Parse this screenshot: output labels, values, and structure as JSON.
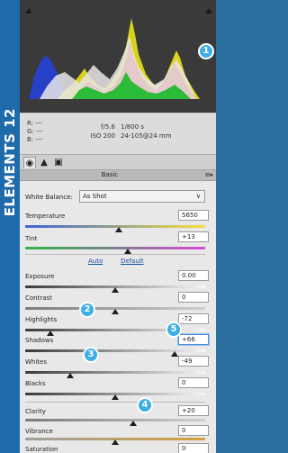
{
  "brand": {
    "label": "ELEMENTS 12",
    "color": "#1f6aa8"
  },
  "callouts": [
    "1",
    "2",
    "3",
    "4",
    "5"
  ],
  "info": {
    "r_label": "R:",
    "r_value": "---",
    "g_label": "G:",
    "g_value": "---",
    "b_label": "B:",
    "b_value": "---",
    "aperture": "f/5.6",
    "shutter": "1/800 s",
    "iso": "ISO 200",
    "lens": "24-105@24 mm"
  },
  "tabs": {
    "basic_icon": "aperture-icon",
    "detail_icon": "triangle-icon",
    "camera_icon": "camera-icon"
  },
  "section": {
    "title": "Basic",
    "menu_glyph": "≡▸"
  },
  "white_balance": {
    "label": "White Balance:",
    "value": "As Shot"
  },
  "controls": [
    {
      "label": "Temperature",
      "value": "5650",
      "level": 0.52
    },
    {
      "label": "Tint",
      "value": "+13",
      "level": 0.57
    },
    {
      "label": "Exposure",
      "value": "0.00",
      "level": 0.5
    },
    {
      "label": "Contrast",
      "value": "0",
      "level": 0.5
    },
    {
      "label": "Highlights",
      "value": "-72",
      "level": 0.14
    },
    {
      "label": "Shadows",
      "value": "+66",
      "level": 0.83
    },
    {
      "label": "Whites",
      "value": "-49",
      "level": 0.25
    },
    {
      "label": "Blacks",
      "value": "0",
      "level": 0.5
    },
    {
      "label": "Clarity",
      "value": "+20",
      "level": 0.6
    },
    {
      "label": "Vibrance",
      "value": "0",
      "level": 0.5
    },
    {
      "label": "Saturation",
      "value": "0",
      "level": 0.5
    }
  ],
  "tone_links": {
    "auto": "Auto",
    "default": "Default"
  }
}
